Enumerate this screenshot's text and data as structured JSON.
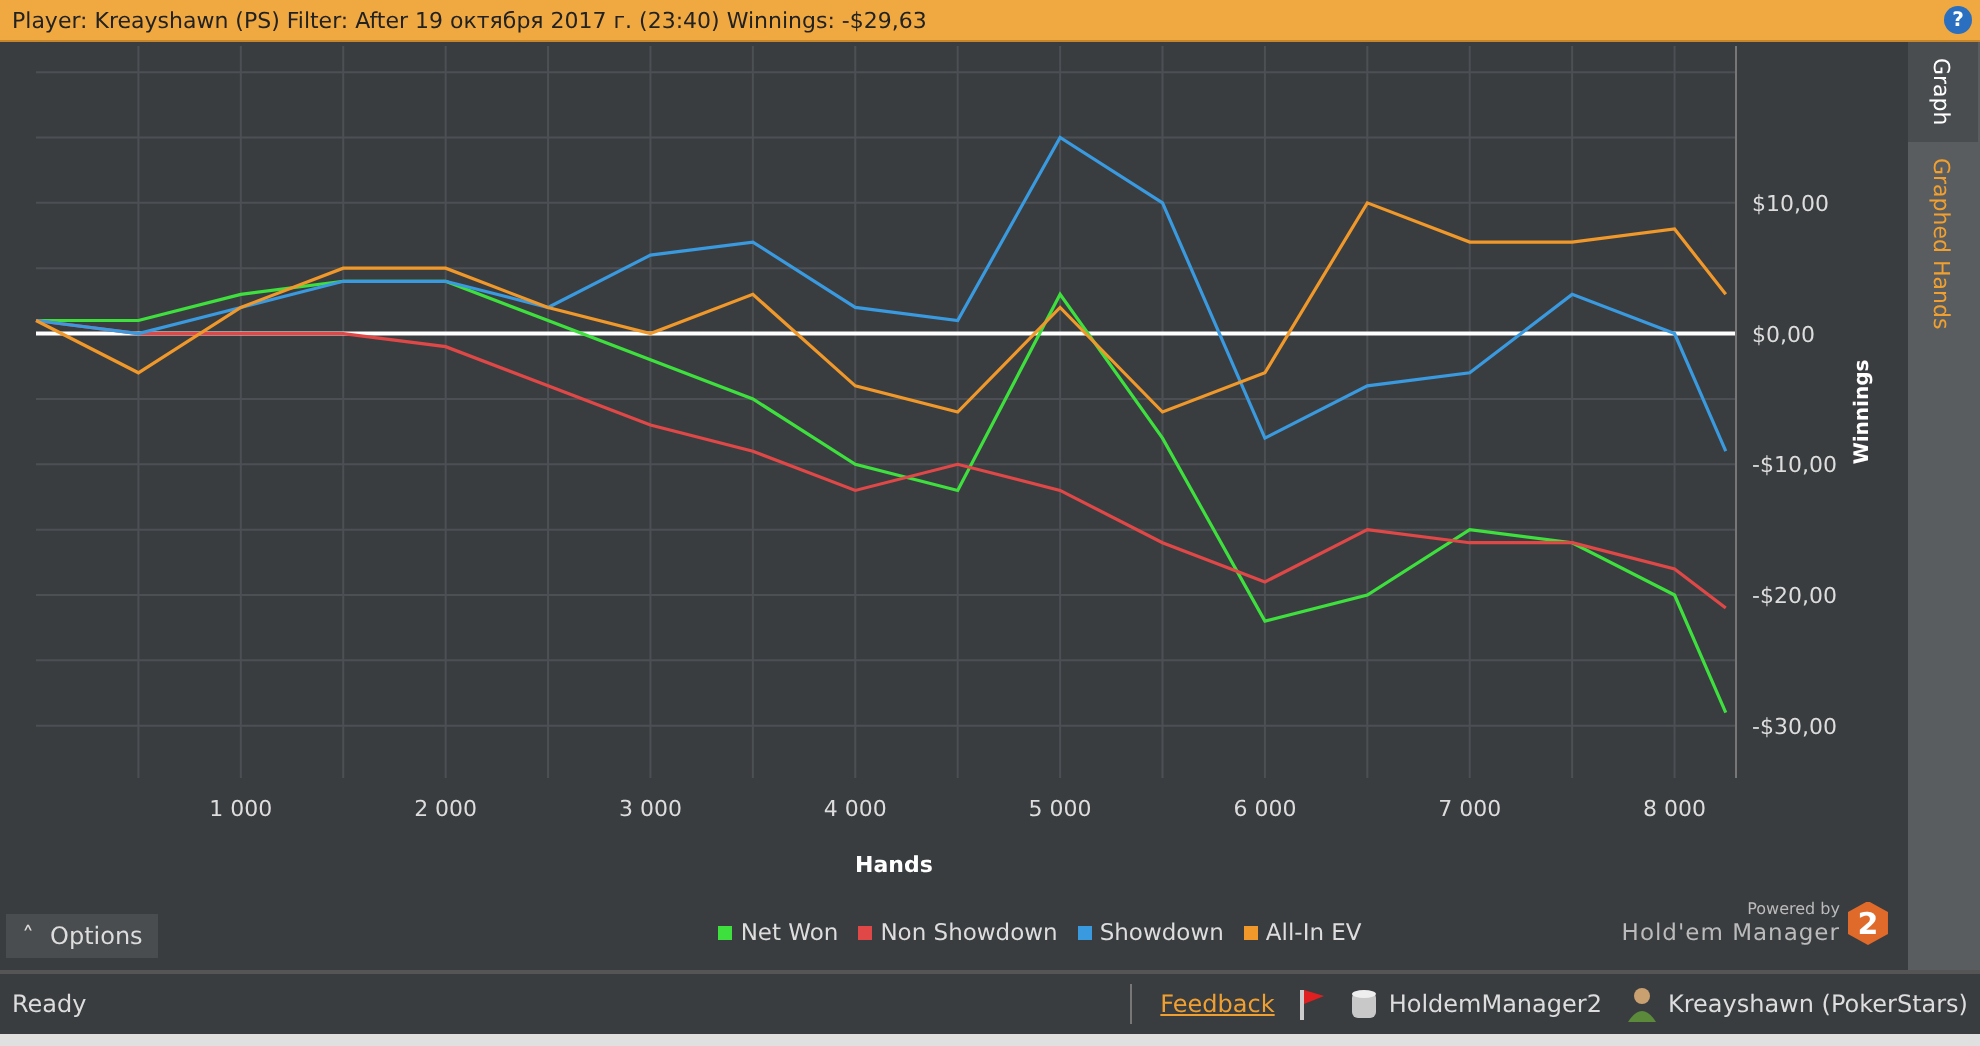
{
  "header": {
    "text": "Player: Kreayshawn (PS) Filter: After 19 октября 2017 г. (23:40) Winnings: -$29,63",
    "help": "?"
  },
  "side_tabs": [
    {
      "label": "Graph",
      "selected": true
    },
    {
      "label": "Graphed Hands",
      "selected": false
    }
  ],
  "chart": {
    "chart_data": {
      "type": "line",
      "grid": true,
      "xlabel": "Hands",
      "ylabel": "Winnings",
      "x": [
        0,
        500,
        1000,
        1500,
        2000,
        2500,
        3000,
        3500,
        4000,
        4500,
        5000,
        5500,
        6000,
        6500,
        7000,
        7500,
        8000,
        8250
      ],
      "xlim": [
        0,
        8300
      ],
      "ylim": [
        -34,
        22
      ],
      "xticks": [
        {
          "value": 1000,
          "label": "1 000"
        },
        {
          "value": 2000,
          "label": "2 000"
        },
        {
          "value": 3000,
          "label": "3 000"
        },
        {
          "value": 4000,
          "label": "4 000"
        },
        {
          "value": 5000,
          "label": "5 000"
        },
        {
          "value": 6000,
          "label": "6 000"
        },
        {
          "value": 7000,
          "label": "7 000"
        },
        {
          "value": 8000,
          "label": "8 000"
        }
      ],
      "yticks": [
        {
          "value": 10,
          "label": "$10,00"
        },
        {
          "value": 0,
          "label": "$0,00"
        },
        {
          "value": -10,
          "label": "-$10,00"
        },
        {
          "value": -20,
          "label": "-$20,00"
        },
        {
          "value": -30,
          "label": "-$30,00"
        }
      ],
      "series": [
        {
          "name": "Net Won",
          "color": "#3ee03e",
          "values": [
            1,
            1,
            3,
            4,
            4,
            1,
            -2,
            -5,
            -10,
            -12,
            3,
            -8,
            -22,
            -20,
            -15,
            -16,
            -20,
            -29
          ]
        },
        {
          "name": "Non Showdown",
          "color": "#e04848",
          "values": [
            1,
            0,
            0,
            0,
            -1,
            -4,
            -7,
            -9,
            -12,
            -10,
            -12,
            -16,
            -19,
            -15,
            -16,
            -16,
            -18,
            -21
          ]
        },
        {
          "name": "Showdown",
          "color": "#3a9ae0",
          "values": [
            1,
            0,
            2,
            4,
            4,
            2,
            6,
            7,
            2,
            1,
            15,
            10,
            -8,
            -4,
            -3,
            3,
            0,
            -9
          ]
        },
        {
          "name": "All-In EV",
          "color": "#f0982a",
          "values": [
            1,
            -3,
            2,
            5,
            5,
            2,
            0,
            3,
            -4,
            -6,
            2,
            -6,
            -3,
            10,
            7,
            7,
            8,
            3
          ]
        }
      ]
    }
  },
  "options_button": {
    "caret": "˄",
    "label": "Options"
  },
  "powered_by": {
    "small": "Powered by",
    "name": "Hold'em Manager",
    "badge": "2"
  },
  "status_bar": {
    "status": "Ready",
    "feedback": "Feedback",
    "database": "HoldemManager2",
    "player": "Kreayshawn (PokerStars)"
  }
}
